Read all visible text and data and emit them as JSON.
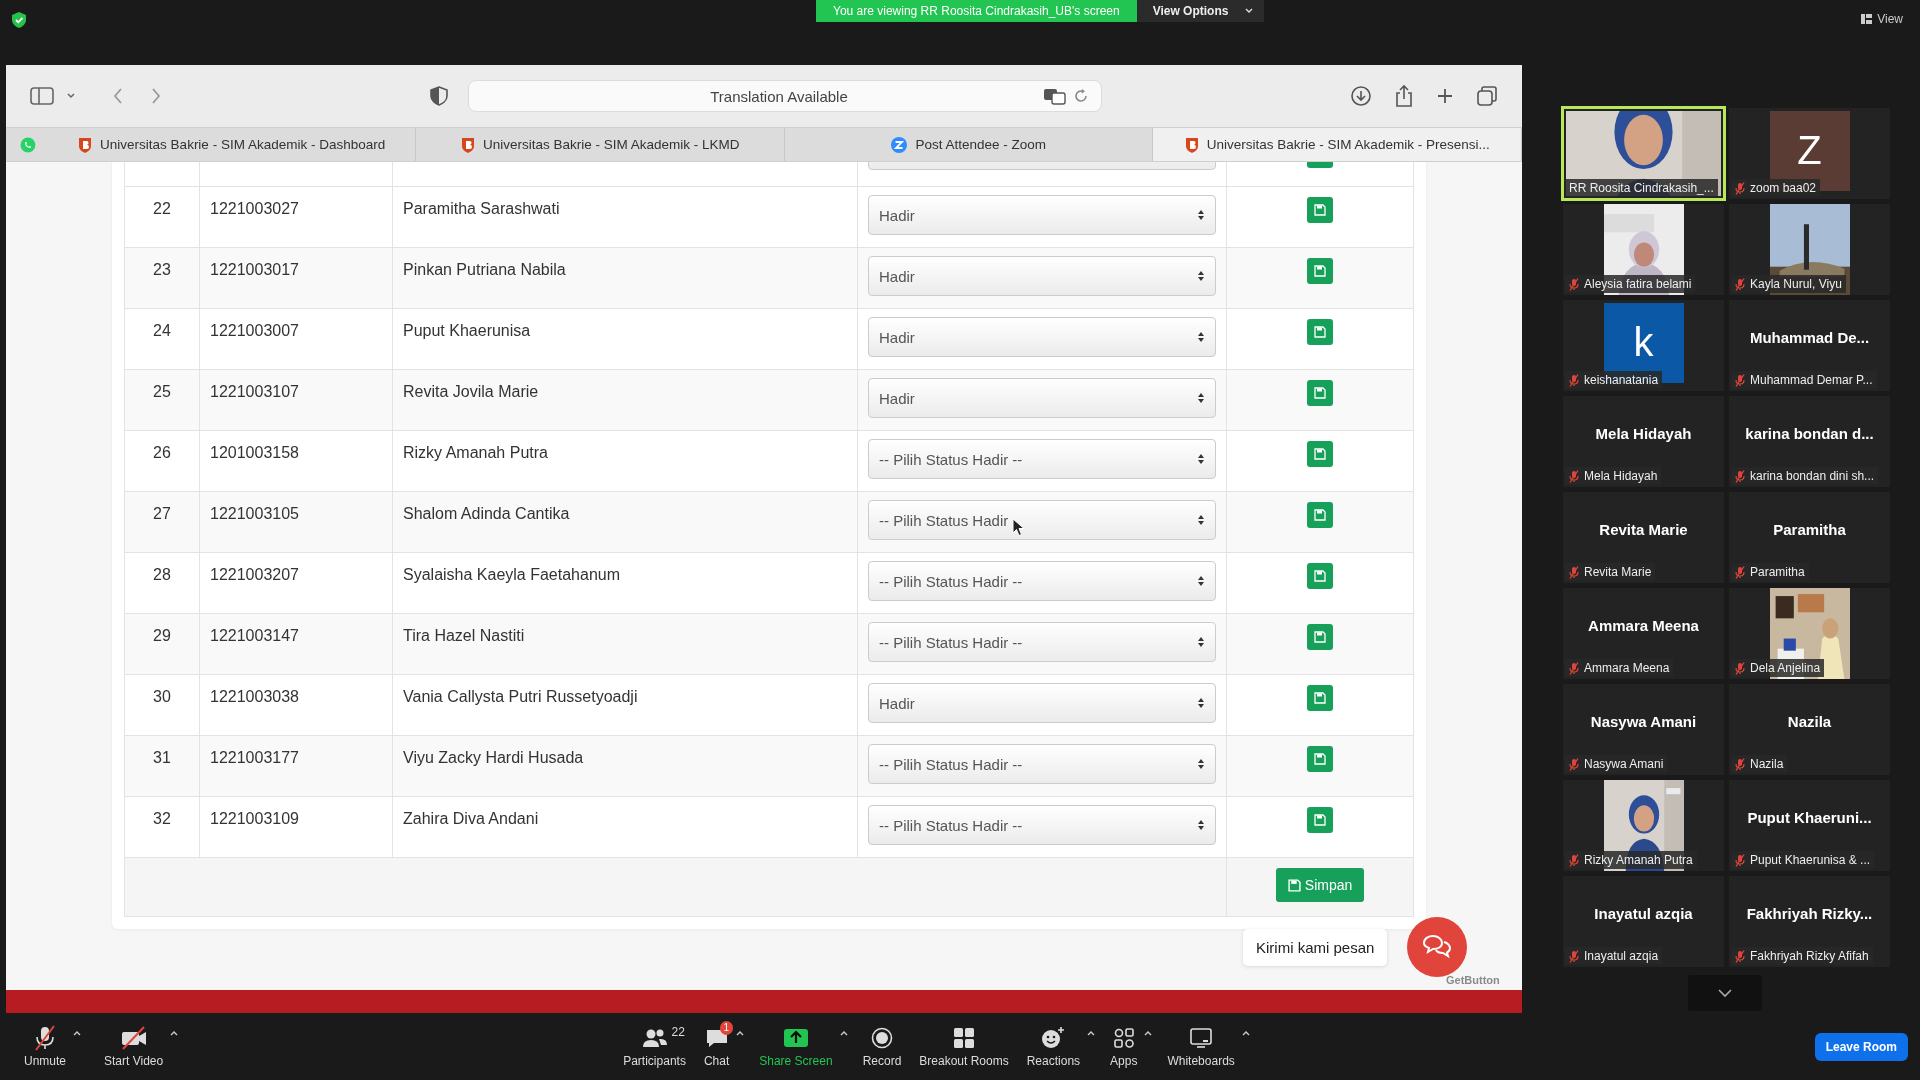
{
  "meeting_bar": {
    "banner": "You are viewing RR Roosita Cindrakasih_UB's screen",
    "view_options": "View Options",
    "view": "View"
  },
  "browser": {
    "address": "Translation Available",
    "tabs": [
      {
        "label": "Universitas Bakrie - SIM Akademik - Dashboard",
        "selected": false
      },
      {
        "label": "Universitas Bakrie - SIM Akademik - LKMD",
        "selected": false
      },
      {
        "label": "Post Attendee - Zoom",
        "selected": false
      },
      {
        "label": "Universitas Bakrie - SIM Akademik - Presensi...",
        "selected": true
      }
    ]
  },
  "table": {
    "rows": [
      {
        "no": "22",
        "nim": "1221003027",
        "name": "Paramitha Sarashwati",
        "status": "Hadir"
      },
      {
        "no": "23",
        "nim": "1221003017",
        "name": "Pinkan Putriana Nabila",
        "status": "Hadir"
      },
      {
        "no": "24",
        "nim": "1221003007",
        "name": "Puput Khaerunisa",
        "status": "Hadir"
      },
      {
        "no": "25",
        "nim": "1221003107",
        "name": "Revita Jovila Marie",
        "status": "Hadir"
      },
      {
        "no": "26",
        "nim": "1201003158",
        "name": "Rizky Amanah Putra",
        "status": "-- Pilih Status Hadir --"
      },
      {
        "no": "27",
        "nim": "1221003105",
        "name": "Shalom Adinda Cantika",
        "status": "-- Pilih Status Hadir",
        "pointer": true
      },
      {
        "no": "28",
        "nim": "1221003207",
        "name": "Syalaisha Kaeyla Faetahanum",
        "status": "-- Pilih Status Hadir --"
      },
      {
        "no": "29",
        "nim": "1221003147",
        "name": "Tira Hazel Nastiti",
        "status": "-- Pilih Status Hadir --"
      },
      {
        "no": "30",
        "nim": "1221003038",
        "name": "Vania Callysta Putri Russetyoadji",
        "status": "Hadir"
      },
      {
        "no": "31",
        "nim": "1221003177",
        "name": "Viyu Zacky Hardi Husada",
        "status": "-- Pilih Status Hadir --"
      },
      {
        "no": "32",
        "nim": "1221003109",
        "name": "Zahira Diva Andani",
        "status": "-- Pilih Status Hadir --"
      }
    ],
    "save_button": "Simpan"
  },
  "chat_widget": {
    "tooltip": "Kirimi kami pesan",
    "brand": "GetButton"
  },
  "gallery": [
    {
      "kind": "video",
      "label": "RR Roosita Cindrakasih_...",
      "muted": false,
      "active": true
    },
    {
      "kind": "avatar",
      "letter": "Z",
      "color": "#5b3c34",
      "label": "zoom baa02",
      "muted": true,
      "active": false
    },
    {
      "kind": "video",
      "label": "Aleysia fatira belami",
      "muted": true,
      "active": false
    },
    {
      "kind": "video",
      "label": "Kayla Nurul, Viyu",
      "muted": true,
      "active": false
    },
    {
      "kind": "avatar",
      "letter": "k",
      "color": "#0b58a6",
      "label": "keishanatania",
      "muted": true,
      "active": false
    },
    {
      "kind": "name",
      "display": "Muhammad  De...",
      "label": "Muhammad Demar P...",
      "muted": true,
      "active": false
    },
    {
      "kind": "name",
      "display": "Mela Hidayah",
      "label": "Mela Hidayah",
      "muted": true,
      "active": false
    },
    {
      "kind": "name",
      "display": "karina  bondan  d...",
      "label": "karina bondan dini sh...",
      "muted": true,
      "active": false
    },
    {
      "kind": "name",
      "display": "Revita Marie",
      "label": "Revita Marie",
      "muted": true,
      "active": false
    },
    {
      "kind": "name",
      "display": "Paramitha",
      "label": "Paramitha",
      "muted": true,
      "active": false
    },
    {
      "kind": "name",
      "display": "Ammara Meena",
      "label": "Ammara Meena",
      "muted": true,
      "active": false
    },
    {
      "kind": "video",
      "label": "Dela Anjelina",
      "muted": true,
      "active": false
    },
    {
      "kind": "name",
      "display": "Nasywa Amani",
      "label": "Nasywa Amani",
      "muted": true,
      "active": false
    },
    {
      "kind": "name",
      "display": "Nazila",
      "label": "Nazila",
      "muted": true,
      "active": false
    },
    {
      "kind": "video",
      "label": "Rizky Amanah Putra",
      "muted": true,
      "active": false
    },
    {
      "kind": "name",
      "display": "Puput  Khaeruni...",
      "label": "Puput Khaerunisa & ...",
      "muted": true,
      "active": false
    },
    {
      "kind": "name",
      "display": "Inayatul azqia",
      "label": "Inayatul azqia",
      "muted": true,
      "active": false
    },
    {
      "kind": "name",
      "display": "Fakhriyah  Rizky...",
      "label": "Fakhriyah Rizky Afifah",
      "muted": true,
      "active": false
    }
  ],
  "toolbar": {
    "left": [
      {
        "label": "Unmute",
        "caret": true
      },
      {
        "label": "Start Video",
        "caret": true
      }
    ],
    "center": [
      {
        "label": "Participants",
        "count": "22",
        "caret": false
      },
      {
        "label": "Chat",
        "badge": "1",
        "caret": true
      },
      {
        "label": "Share Screen",
        "caret": true
      },
      {
        "label": "Record",
        "caret": false
      },
      {
        "label": "Breakout Rooms",
        "caret": false
      },
      {
        "label": "Reactions",
        "caret": true
      },
      {
        "label": "Apps",
        "caret": true
      },
      {
        "label": "Whiteboards",
        "caret": true
      }
    ],
    "leave": "Leave Room"
  }
}
